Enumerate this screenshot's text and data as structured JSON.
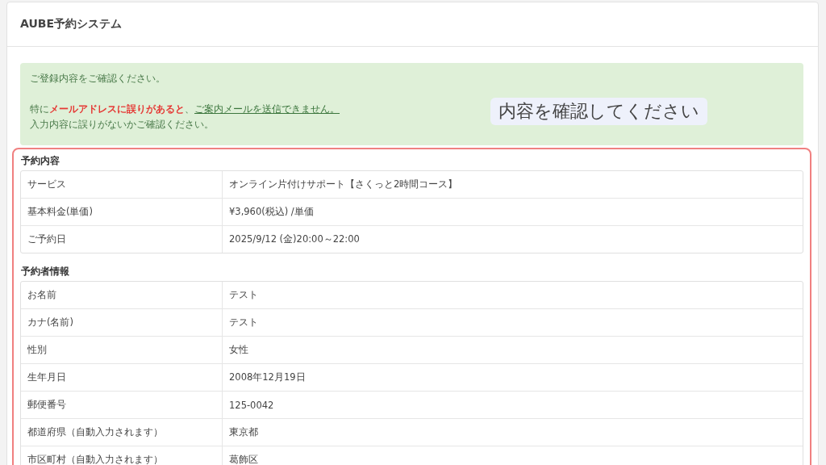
{
  "header": {
    "title": "AUBE予約システム"
  },
  "alert": {
    "intro": "ご登録内容をご確認ください。",
    "warning": "特に**メールアドレスに誤りがあると**、",
    "link": "ご案内メールを送信できません。",
    "closing": "入力内容に誤りがないかご確認ください。"
  },
  "callout": {
    "text": "内容を確認してください"
  },
  "sections": [
    {
      "title": "予約内容",
      "rows": [
        {
          "label": "サービス",
          "value": "オンライン片付けサポート【さくっと2時間コース】"
        },
        {
          "label": "基本料金(単価)",
          "value": "¥3,960(税込) /単価"
        },
        {
          "label": "ご予約日",
          "value": "2025/9/12 (金)20:00～22:00"
        }
      ]
    },
    {
      "title": "予約者情報",
      "rows": [
        {
          "label": "お名前",
          "value": "テスト"
        },
        {
          "label": "カナ(名前)",
          "value": "テスト"
        },
        {
          "label": "性別",
          "value": "女性"
        },
        {
          "label": "生年月日",
          "value": "2008年12月19日"
        },
        {
          "label": "郵便番号",
          "value": "125-0042"
        },
        {
          "label": "都道府県（自動入力されます）",
          "value": "東京都"
        },
        {
          "label": "市区町村（自動入力されます）",
          "value": "葛飾区"
        }
      ]
    }
  ]
}
